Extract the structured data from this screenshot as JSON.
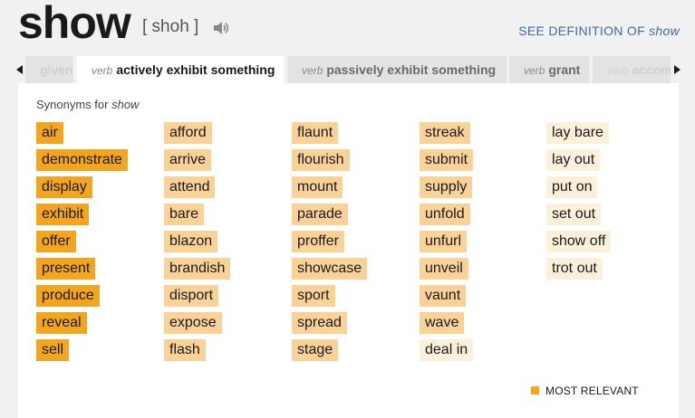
{
  "header": {
    "word": "show",
    "pronunciation": "[ shoh ]",
    "speaker_icon": "speaker-icon",
    "see_definition_prefix": "SEE DEFINITION OF ",
    "see_definition_word": "show"
  },
  "tabs": [
    {
      "pos": "",
      "label": "given",
      "state": "faded"
    },
    {
      "pos": "verb",
      "label": "actively exhibit something",
      "state": "active"
    },
    {
      "pos": "verb",
      "label": "passively exhibit something",
      "state": "inactive"
    },
    {
      "pos": "verb",
      "label": "grant",
      "state": "inactive"
    },
    {
      "pos": "verb",
      "label": "accom",
      "state": "faded"
    }
  ],
  "synonyms_title_prefix": "Synonyms for ",
  "synonyms_title_word": "show",
  "columns": [
    [
      {
        "word": "air",
        "relevance": 3
      },
      {
        "word": "demonstrate",
        "relevance": 3
      },
      {
        "word": "display",
        "relevance": 3
      },
      {
        "word": "exhibit",
        "relevance": 3
      },
      {
        "word": "offer",
        "relevance": 3
      },
      {
        "word": "present",
        "relevance": 3
      },
      {
        "word": "produce",
        "relevance": 3
      },
      {
        "word": "reveal",
        "relevance": 3
      },
      {
        "word": "sell",
        "relevance": 3
      }
    ],
    [
      {
        "word": "afford",
        "relevance": 2
      },
      {
        "word": "arrive",
        "relevance": 2
      },
      {
        "word": "attend",
        "relevance": 2
      },
      {
        "word": "bare",
        "relevance": 2
      },
      {
        "word": "blazon",
        "relevance": 2
      },
      {
        "word": "brandish",
        "relevance": 2
      },
      {
        "word": "disport",
        "relevance": 2
      },
      {
        "word": "expose",
        "relevance": 2
      },
      {
        "word": "flash",
        "relevance": 2
      }
    ],
    [
      {
        "word": "flaunt",
        "relevance": 2
      },
      {
        "word": "flourish",
        "relevance": 2
      },
      {
        "word": "mount",
        "relevance": 2
      },
      {
        "word": "parade",
        "relevance": 2
      },
      {
        "word": "proffer",
        "relevance": 2
      },
      {
        "word": "showcase",
        "relevance": 2
      },
      {
        "word": "sport",
        "relevance": 2
      },
      {
        "word": "spread",
        "relevance": 2
      },
      {
        "word": "stage",
        "relevance": 2
      }
    ],
    [
      {
        "word": "streak",
        "relevance": 2
      },
      {
        "word": "submit",
        "relevance": 2
      },
      {
        "word": "supply",
        "relevance": 2
      },
      {
        "word": "unfold",
        "relevance": 2
      },
      {
        "word": "unfurl",
        "relevance": 2
      },
      {
        "word": "unveil",
        "relevance": 2
      },
      {
        "word": "vaunt",
        "relevance": 2
      },
      {
        "word": "wave",
        "relevance": 2
      },
      {
        "word": "deal in",
        "relevance": 1
      }
    ],
    [
      {
        "word": "lay bare",
        "relevance": 1
      },
      {
        "word": "lay out",
        "relevance": 1
      },
      {
        "word": "put on",
        "relevance": 1
      },
      {
        "word": "set out",
        "relevance": 1
      },
      {
        "word": "show off",
        "relevance": 1
      },
      {
        "word": "trot out",
        "relevance": 1
      }
    ]
  ],
  "legend": {
    "label": "MOST RELEVANT"
  },
  "colors": {
    "most_relevant": "#f3a51f",
    "relevant": "#fad298",
    "less_relevant": "#fdf0da",
    "link": "#3a6aa8"
  }
}
